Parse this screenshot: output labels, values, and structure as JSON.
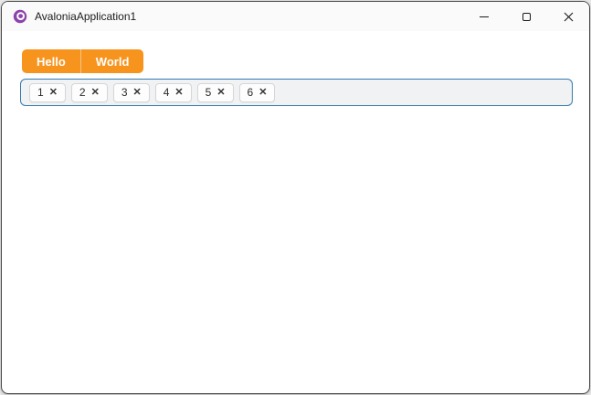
{
  "window": {
    "title": "AvaloniaApplication1",
    "border_color": "#4a4a4a",
    "titlebar_bg": "#fafafa"
  },
  "titlebar": {
    "buttons": {
      "minimize_label": "Minimize",
      "maximize_label": "Maximize",
      "close_label": "Close",
      "close_glyph": "icon-x"
    },
    "app_icon": "avalonia-logo",
    "icon_color": "#8b44ac"
  },
  "tab_strip": {
    "accent_color": "#F7941E",
    "text_color": "#ffffff",
    "items": [
      {
        "label": "Hello"
      },
      {
        "label": "World"
      }
    ]
  },
  "chip_box": {
    "border_color": "#3279AE",
    "background": "#f1f2f3",
    "remove_glyph": "✕",
    "chips": [
      {
        "label": "1"
      },
      {
        "label": "2"
      },
      {
        "label": "3"
      },
      {
        "label": "4"
      },
      {
        "label": "5"
      },
      {
        "label": "6"
      }
    ]
  }
}
